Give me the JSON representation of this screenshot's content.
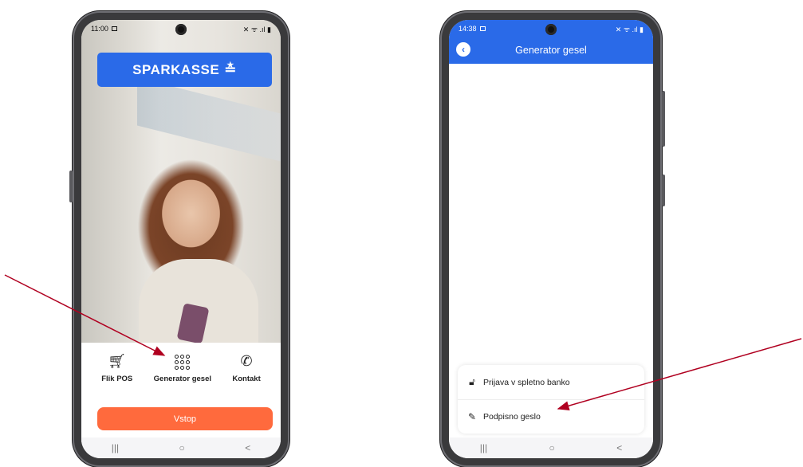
{
  "phone_left": {
    "status": {
      "time": "11:00",
      "icons": "✕ ᯤ .ıl ▮"
    },
    "brand": {
      "name": "SPARKASSE",
      "logo_glyph": "≛"
    },
    "nav": [
      {
        "label": "Flik POS",
        "icon": "cart-icon"
      },
      {
        "label": "Generator gesel",
        "icon": "keypad-icon"
      },
      {
        "label": "Kontakt",
        "icon": "phone-icon"
      }
    ],
    "cta_label": "Vstop"
  },
  "phone_right": {
    "status": {
      "time": "14:38",
      "icons": "✕ ᯤ .ıl ▮"
    },
    "appbar_title": "Generator gesel",
    "options": [
      {
        "label": "Prijava v spletno banko",
        "icon": "lock-icon"
      },
      {
        "label": "Podpisno geslo",
        "icon": "pen-icon"
      }
    ]
  },
  "system_nav": {
    "recents": "|||",
    "home": "○",
    "back": "<"
  },
  "colors": {
    "brand_blue": "#2a6ae8",
    "cta_orange": "#ff6a3d",
    "arrow_red": "#b00020"
  }
}
